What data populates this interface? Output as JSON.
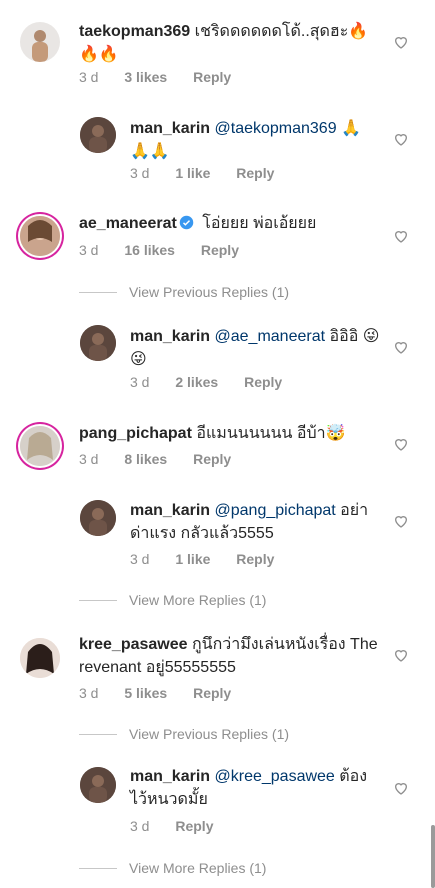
{
  "comments": [
    {
      "username": "taekopman369",
      "text": "เชริดดดดดดโด้..สุดฮะ🔥🔥🔥",
      "time": "3 d",
      "likes": "3 likes",
      "reply": "Reply"
    },
    {
      "username": "man_karin",
      "mention": "@taekopman369",
      "text": " 🙏🙏🙏",
      "time": "3 d",
      "likes": "1 like",
      "reply": "Reply"
    },
    {
      "username": "ae_maneerat",
      "text": " โอ่ยยย พ่อเอ้ยยย",
      "time": "3 d",
      "likes": "16 likes",
      "reply": "Reply"
    },
    {
      "username": "man_karin",
      "mention": "@ae_maneerat",
      "text": " อิอิอิ 😜😜",
      "time": "3 d",
      "likes": "2 likes",
      "reply": "Reply"
    },
    {
      "username": "pang_pichapat",
      "text": " อีแมนนนนนน อีบ้า🤯",
      "time": "3 d",
      "likes": "8 likes",
      "reply": "Reply"
    },
    {
      "username": "man_karin",
      "mention": "@pang_pichapat",
      "text": " อย่าด่าแรง กลัวแล้ว5555",
      "time": "3 d",
      "likes": "1 like",
      "reply": "Reply"
    },
    {
      "username": "kree_pasawee",
      "text": " กูนึกว่ามึงเล่นหนังเรื่อง The revenant อยู่55555555",
      "time": "3 d",
      "likes": "5 likes",
      "reply": "Reply"
    },
    {
      "username": "man_karin",
      "mention": "@kree_pasawee",
      "text": " ต้องไว้หนวดมั้ย",
      "time": "3 d",
      "reply": "Reply"
    }
  ],
  "links": {
    "previous_1": "View Previous Replies (1)",
    "more_1": "View More Replies (1)",
    "previous_2": "View Previous Replies (1)",
    "more_2": "View More Replies (1)"
  },
  "colors": {
    "mention": "#00376b",
    "meta": "#8e8e8e",
    "verified": "#3897f0"
  }
}
